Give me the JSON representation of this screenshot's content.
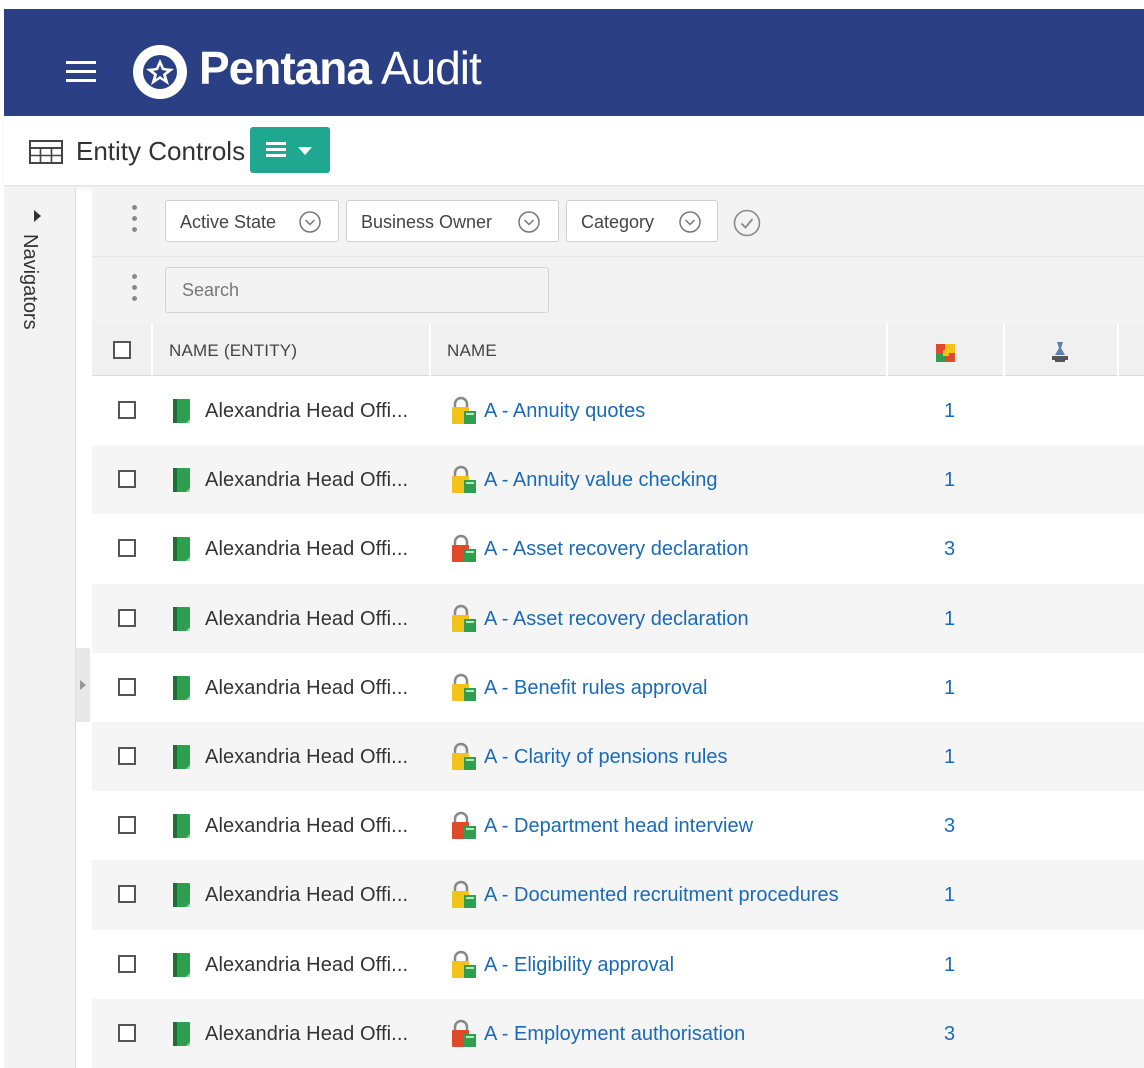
{
  "header": {
    "brand_bold": "Pentana",
    "brand_light": "Audit"
  },
  "toolbar": {
    "title": "Entity Controls"
  },
  "navigators": {
    "label": "Navigators"
  },
  "filters": [
    {
      "label": "Active State"
    },
    {
      "label": "Business Owner"
    },
    {
      "label": "Category"
    }
  ],
  "search": {
    "placeholder": "Search",
    "value": ""
  },
  "table": {
    "columns": [
      "NAME (ENTITY)",
      "NAME"
    ],
    "rows": [
      {
        "entity": "Alexandria Head Offi...",
        "control": "A - Annuity quotes",
        "count": "1",
        "status": "yellow"
      },
      {
        "entity": "Alexandria Head Offi...",
        "control": "A - Annuity value checking",
        "count": "1",
        "status": "yellow"
      },
      {
        "entity": "Alexandria Head Offi...",
        "control": "A - Asset recovery declaration",
        "count": "3",
        "status": "red"
      },
      {
        "entity": "Alexandria Head Offi...",
        "control": "A - Asset recovery declaration",
        "count": "1",
        "status": "yellow"
      },
      {
        "entity": "Alexandria Head Offi...",
        "control": "A - Benefit rules approval",
        "count": "1",
        "status": "yellow"
      },
      {
        "entity": "Alexandria Head Offi...",
        "control": "A - Clarity of pensions rules",
        "count": "1",
        "status": "yellow"
      },
      {
        "entity": "Alexandria Head Offi...",
        "control": "A - Department head interview",
        "count": "3",
        "status": "red"
      },
      {
        "entity": "Alexandria Head Offi...",
        "control": "A - Documented recruitment procedures",
        "count": "1",
        "status": "yellow"
      },
      {
        "entity": "Alexandria Head Offi...",
        "control": "A - Eligibility approval",
        "count": "1",
        "status": "yellow"
      },
      {
        "entity": "Alexandria Head Offi...",
        "control": "A - Employment authorisation",
        "count": "3",
        "status": "red"
      }
    ]
  },
  "colors": {
    "header_bg": "#2b3f84",
    "accent": "#1fa88f",
    "link": "#1a6ab8",
    "status_yellow": "#f2c418",
    "status_red": "#e04a2a",
    "entity_green": "#2e9e4f"
  }
}
